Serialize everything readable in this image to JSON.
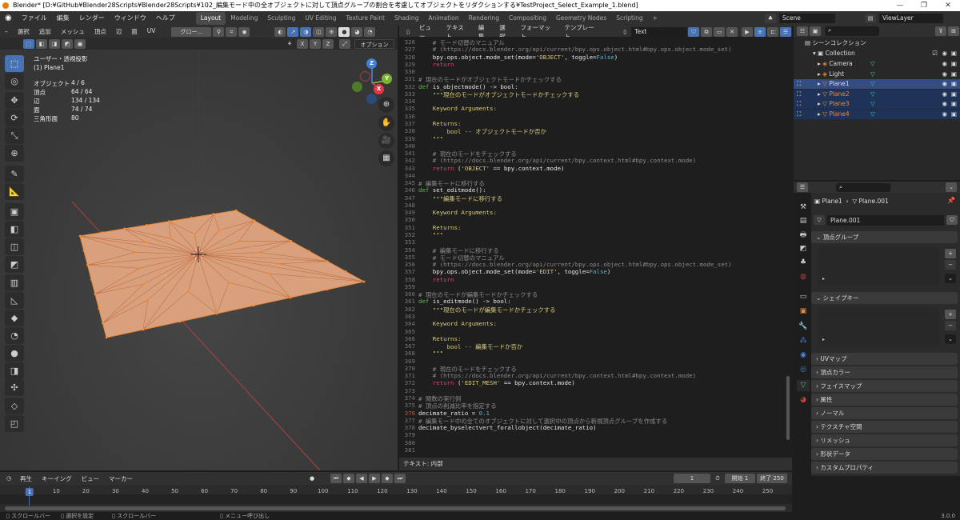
{
  "window": {
    "title": "Blender* [D:¥GitHub¥Blender28Scripts¥Blender28Scripts¥102_編集モード中の全オブジェクトに対して頂点グループの割合を考慮してオブジェクトをリダクションする¥TestProject_Select_Example_1.blend]",
    "minimize": "—",
    "maximize": "❐",
    "close": "✕"
  },
  "topbar": {
    "menus": [
      "ファイル",
      "編集",
      "レンダー",
      "ウィンドウ",
      "ヘルプ"
    ],
    "workspaces": [
      "Layout",
      "Modeling",
      "Sculpting",
      "UV Editing",
      "Texture Paint",
      "Shading",
      "Animation",
      "Rendering",
      "Compositing",
      "Geometry Nodes",
      "Scripting",
      "+"
    ],
    "active_workspace": "Layout",
    "scene": "Scene",
    "view_layer": "ViewLayer"
  },
  "viewport": {
    "menus": [
      "選択",
      "追加",
      "メッシュ",
      "頂点",
      "辺",
      "面",
      "UV"
    ],
    "transform_orientation": "グロー...",
    "axes": [
      "X",
      "Y",
      "Z"
    ],
    "options": "オプション",
    "view_name": "ユーザー・透視投影",
    "object_name": "(1) Plane1",
    "stats": [
      {
        "label": "オブジェクト",
        "value": "4 / 6"
      },
      {
        "label": "頂点",
        "value": "64 / 64"
      },
      {
        "label": "辺",
        "value": "134 / 134"
      },
      {
        "label": "面",
        "value": "74 / 74"
      },
      {
        "label": "三角形面",
        "value": "80"
      }
    ],
    "gizmo": {
      "x": "X",
      "y": "Y",
      "z": "Z"
    },
    "colors": {
      "mesh": "#e8a57a",
      "x_axis": "#c83c3c",
      "accent": "#4772b3"
    }
  },
  "text_editor": {
    "menus": [
      "ビュー",
      "テキスト",
      "編集",
      "選択",
      "フォーマット",
      "テンプレート"
    ],
    "text_name": "Text",
    "footer": "テキスト: 内部",
    "current_line": 376,
    "first_line": 326,
    "lines": [
      "    # モード切替のマニュアル",
      "    # (https://docs.blender.org/api/current/bpy.ops.object.html#bpy.ops.object.mode_set)",
      "    bpy.ops.object.mode_set(mode='OBJECT', toggle=False)",
      "    return",
      "",
      "# 現在のモードがオブジェクトモードかチェックする",
      "def is_objectmode() -> bool:",
      "    \"\"\"現在のモードがオブジェクトモードかチェックする",
      "",
      "    Keyword Arguments:",
      "",
      "    Returns:",
      "        bool -- オブジェクトモードか否か",
      "    \"\"\"",
      "",
      "    # 現在のモードをチェックする",
      "    # (https://docs.blender.org/api/current/bpy.context.html#bpy.context.mode)",
      "    return ('OBJECT' == bpy.context.mode)",
      "",
      "# 編集モードに移行する",
      "def set_editmode():",
      "    \"\"\"編集モードに移行する",
      "",
      "    Keyword Arguments:",
      "",
      "    Returns:",
      "    \"\"\"",
      "",
      "    # 編集モードに移行する",
      "    # モード切替のマニュアル",
      "    # (https://docs.blender.org/api/current/bpy.ops.object.html#bpy.ops.object.mode_set)",
      "    bpy.ops.object.mode_set(mode='EDIT', toggle=False)",
      "    return",
      "",
      "# 現在のモードが編集モードかチェックする",
      "def is_editmode() -> bool:",
      "    \"\"\"現在のモードが編集モードかチェックする",
      "",
      "    Keyword Arguments:",
      "",
      "    Returns:",
      "        bool -- 編集モードか否か",
      "    \"\"\"",
      "",
      "    # 現在のモードをチェックする",
      "    # (https://docs.blender.org/api/current/bpy.context.html#bpy.context.mode)",
      "    return ('EDIT_MESH' == bpy.context.mode)",
      "",
      "# 関数の実行例",
      "# 頂点の削減比率を指定する",
      "decimate_ratio = 0.1",
      "# 編集モード中の全てのオブジェクトに対して選択中の頂点から新規頂点グループを作成する",
      "decimate_byselectvert_forallobject(decimate_ratio)",
      "",
      "",
      ""
    ]
  },
  "outliner": {
    "root": "シーンコレクション",
    "collection": "Collection",
    "objects": [
      {
        "name": "Camera",
        "selected": false
      },
      {
        "name": "Light",
        "selected": false
      },
      {
        "name": "Plane1",
        "selected": true
      },
      {
        "name": "Plane2",
        "selected": true
      },
      {
        "name": "Plane3",
        "selected": true
      },
      {
        "name": "Plane4",
        "selected": true
      }
    ]
  },
  "properties": {
    "breadcrumb_object": "Plane1",
    "breadcrumb_mesh": "Plane.001",
    "mesh_name": "Plane.001",
    "panels_open": [
      "頂点グループ",
      "シェイプキー"
    ],
    "panels_closed": [
      "UVマップ",
      "頂点カラー",
      "フェイスマップ",
      "属性",
      "ノーマル",
      "テクスチャ空間",
      "リメッシュ",
      "形状データ",
      "カスタムプロパティ"
    ]
  },
  "timeline": {
    "menus": [
      "再生",
      "キーイング",
      "ビュー",
      "マーカー"
    ],
    "current_frame": "1",
    "start_label": "開始",
    "start": "1",
    "end_label": "終了",
    "end": "250",
    "ticks": [
      "1",
      "10",
      "20",
      "30",
      "40",
      "50",
      "60",
      "70",
      "80",
      "90",
      "100",
      "110",
      "120",
      "130",
      "140",
      "150",
      "160",
      "170",
      "180",
      "190",
      "200",
      "210",
      "220",
      "230",
      "240",
      "250"
    ]
  },
  "statusbar": {
    "items": [
      "スクロールバー",
      "選択を設定",
      "スクロールバー",
      "メニュー呼び出し"
    ],
    "version": "3.0.0"
  }
}
